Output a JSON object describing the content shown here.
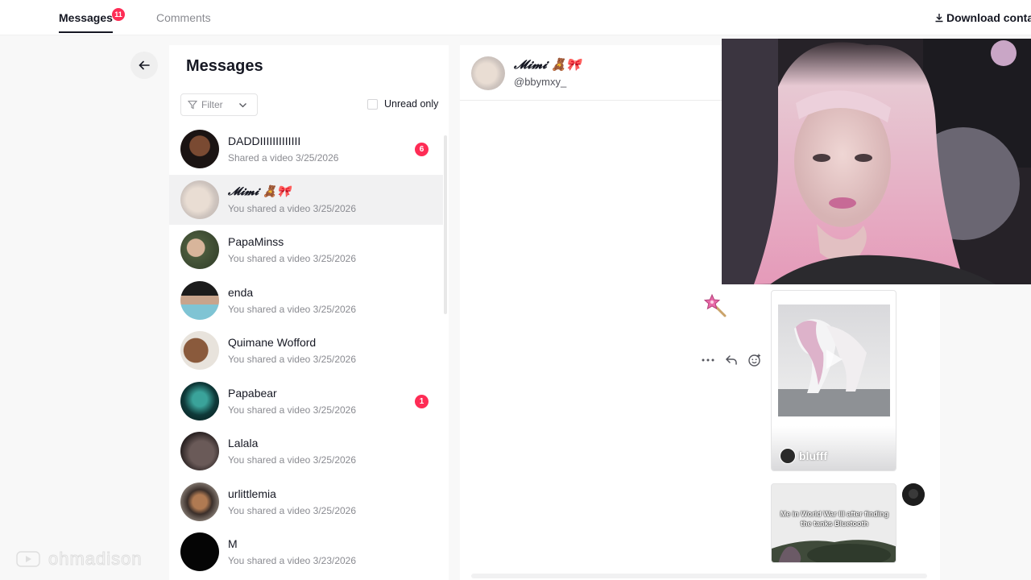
{
  "nav": {
    "tabs": [
      {
        "label": "Messages",
        "badge": "11",
        "active": true
      },
      {
        "label": "Comments",
        "active": false
      }
    ],
    "download_label": "Download conta"
  },
  "inbox": {
    "title": "Messages",
    "filter_label": "Filter",
    "unread_only_label": "Unread only",
    "conversations": [
      {
        "name": "DADDIIIIIIIIIIIII",
        "preview": "Shared a video 3/25/2026",
        "unread": "6"
      },
      {
        "name": "𝓜𝓲𝓶𝓲 🧸🎀",
        "preview": "You shared a video 3/25/2026",
        "unread": ""
      },
      {
        "name": "PapaMinss",
        "preview": "You shared a video 3/25/2026",
        "unread": ""
      },
      {
        "name": "enda",
        "preview": "You shared a video 3/25/2026",
        "unread": ""
      },
      {
        "name": "Quimane Wofford",
        "preview": "You shared a video 3/25/2026",
        "unread": ""
      },
      {
        "name": "Papabear",
        "preview": "You shared a video 3/25/2026",
        "unread": "1"
      },
      {
        "name": "Lalala",
        "preview": "You shared a video 3/25/2026",
        "unread": ""
      },
      {
        "name": "urlittlemia",
        "preview": "You shared a video 3/25/2026",
        "unread": ""
      },
      {
        "name": "M",
        "preview": "You shared a video 3/23/2026",
        "unread": ""
      }
    ]
  },
  "chat": {
    "name": "𝓜𝓲𝓶𝓲 🧸🎀",
    "handle": "@bbymxy_",
    "shared_video": {
      "username": "blufff"
    },
    "shared_video_2": {
      "caption": "Me in World War III after finding the tanks Bluetooth"
    }
  },
  "watermark": {
    "text": "ohmadison"
  },
  "colors": {
    "accent": "#fe2c55",
    "text": "#161823",
    "muted": "#8a8b91",
    "background": "#f8f8f8"
  },
  "icons": [
    "arrow-left-icon",
    "filter-icon",
    "chevron-down-icon",
    "download-icon",
    "more-icon",
    "reply-icon",
    "emoji-react-icon",
    "magic-wand-icon",
    "play-icon"
  ]
}
